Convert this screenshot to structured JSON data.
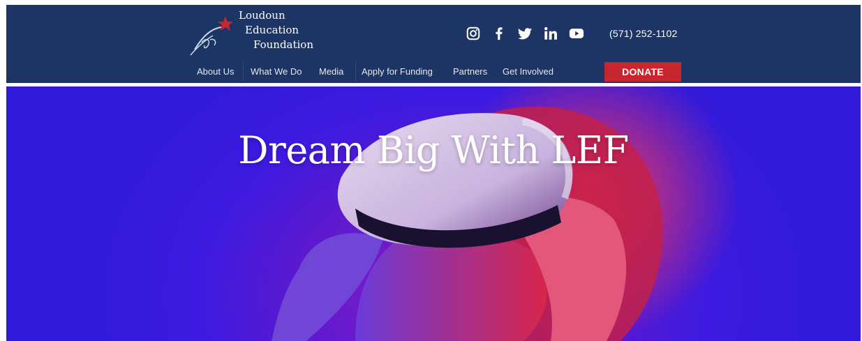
{
  "brand": {
    "line1": "Loudoun",
    "line2": "Education",
    "line3": "Foundation"
  },
  "social": {
    "icons": [
      "instagram-icon",
      "facebook-icon",
      "twitter-icon",
      "linkedin-icon",
      "youtube-icon"
    ]
  },
  "contact": {
    "phone": "(571) 252-1102"
  },
  "nav": {
    "items": [
      {
        "label": "About Us"
      },
      {
        "label": "What We Do"
      },
      {
        "label": "Media"
      },
      {
        "label": "Apply for Funding"
      },
      {
        "label": "Partners"
      },
      {
        "label": "Get Involved"
      }
    ],
    "donate_label": "DONATE"
  },
  "hero": {
    "title": "Dream Big With LEF"
  },
  "colors": {
    "header_bg": "#1c3565",
    "donate_bg": "#c8262f",
    "hero_purple": "#5a19d0",
    "hero_red": "#e8273f"
  }
}
